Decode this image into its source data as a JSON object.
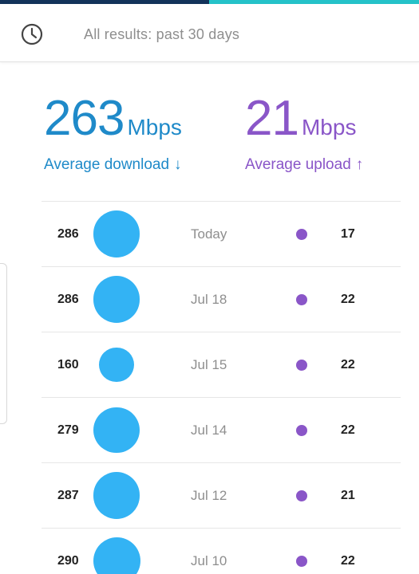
{
  "filter": {
    "icon": "clock-icon",
    "text": "All results: past 30 days"
  },
  "summary": {
    "download": {
      "value": "263",
      "unit": "Mbps",
      "caption": "Average download",
      "arrow": "↓",
      "color": "#1f8ac9"
    },
    "upload": {
      "value": "21",
      "unit": "Mbps",
      "caption": "Average upload",
      "arrow": "↑",
      "color": "#8a56c8"
    }
  },
  "colors": {
    "download_bubble": "#33b3f4",
    "upload_dot": "#8a56c8",
    "top_bar_dark": "#13335a",
    "top_bar_accent": "#24c2c9"
  },
  "results": [
    {
      "download": 286,
      "date": "Today",
      "upload": 17
    },
    {
      "download": 286,
      "date": "Jul 18",
      "upload": 22
    },
    {
      "download": 160,
      "date": "Jul 15",
      "upload": 22
    },
    {
      "download": 279,
      "date": "Jul 14",
      "upload": 22
    },
    {
      "download": 287,
      "date": "Jul 12",
      "upload": 21
    },
    {
      "download": 290,
      "date": "Jul 10",
      "upload": 22
    }
  ]
}
